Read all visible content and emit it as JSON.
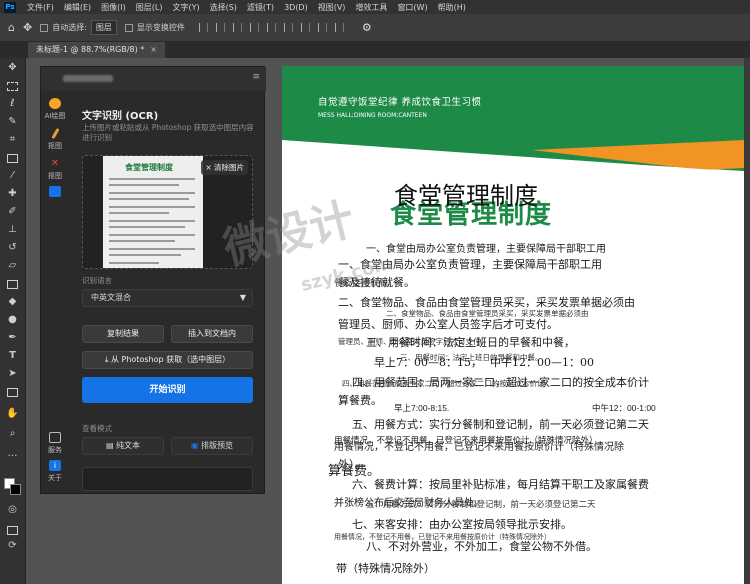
{
  "menubar": {
    "logo": "Ps",
    "items": [
      "文件(F)",
      "编辑(E)",
      "图像(I)",
      "图层(L)",
      "文字(Y)",
      "选择(S)",
      "滤镜(T)",
      "3D(D)",
      "视图(V)",
      "增效工具",
      "窗口(W)",
      "帮助(H)"
    ]
  },
  "options": {
    "auto_select_label": "自动选择:",
    "auto_select_value": "图层",
    "show_transform_label": "显示变换控件"
  },
  "tab": {
    "title": "未标题-1 @ 88.7%(RGB/8) *",
    "close": "×"
  },
  "sidestrip": {
    "items": [
      "AI绘图",
      "抠图",
      "抠图",
      "",
      "服务",
      "关于"
    ]
  },
  "panel": {
    "title": "文字识别 (OCR)",
    "description": "上传图片或粘贴或从 Photoshop 获取选中图层内容进行识别",
    "thumb_title": "食堂管理制度",
    "remove_image": "× 清除图片",
    "lang_label": "识别语言",
    "lang_value": "中英文混合",
    "copy_result": "复制结果",
    "insert_doc": "插入到文档内",
    "get_from_ps": "从 Photoshop 获取（选中图层）",
    "start": "开始识别",
    "view_label": "查看模式",
    "view_plain": "纯文本",
    "view_layout": "排版预览"
  },
  "doc": {
    "header_cn": "自觉遵守饭堂纪律  养成饮食卫生习惯",
    "header_en": "MESS HALL;DINING ROOM;CANTEEN",
    "title_ocr": "食堂管理制度",
    "title_orig": "食堂管理制度",
    "l1a": "一、食堂由局办公室负责管理，主要保障局干部职工用",
    "l1b": "一、食堂由局办公室负责管理，主要保障局干部职工用",
    "l1c": "餐及接待就餐。",
    "l1d": "餐及接待就餐。",
    "l2a": "二、食堂物品、食品由食堂管理员采买，采买发票单据必须由",
    "l2b": "二、食堂物品、食品由食堂管理员采买，采买发票单据必须由",
    "l2c": "管理员、厨师、办公室人员签字后才可支付。",
    "l2d": "管理员、厨师、办公室人员签字后才可支付。",
    "l3a": "三、用餐时间：法定上班日的早餐和中餐，",
    "l3b": "三、用餐时间：法定上班日的早餐和中餐。",
    "l3c": "早上7：00—8：15，",
    "l3d": "中午12：00—1：00",
    "l4a": "四、用餐范围：局两一家二口，超过一家二口的按全成本价计",
    "l4b": "四、用餐范围：局两一家二口，超过一家二口的按全成本价计",
    "l4c": "算餐费。",
    "l4d": "早上7:00-8:15.",
    "l4e": "中午12：00-1:00",
    "l5a": "五、用餐方式：实行分餐制和登记制，前一天必须登记第二天",
    "l5b": "用餐情况，不登记不用餐，已登记不来用餐按原价计（特殊情况除外）",
    "l5c": "用餐情况，不登记不用餐，已登记不来用餐按原价计（特殊情况除",
    "l5d": "外）。",
    "l5e": "算餐费。",
    "l6a": "六、餐费计算：按局里补贴标准，每月结算干职工及家属餐费",
    "l6b": "并张榜公布后交至局财务人员处。",
    "l6c": "五、用餐方式：实行分餐制和登记制，前一天必须登记第二天",
    "l7a": "七、来客安排：由办公室按局领导批示安排。",
    "l7b": "用餐情况，不登记不用餐，已登记不来用餐按原价计（特殊情况除外）",
    "l8a": "八、不对外营业，不外加工，食堂公物不外借。",
    "l8b": "带（特殊情况除外）"
  },
  "watermark": {
    "text": "微设计",
    "url": "szyk.com"
  }
}
